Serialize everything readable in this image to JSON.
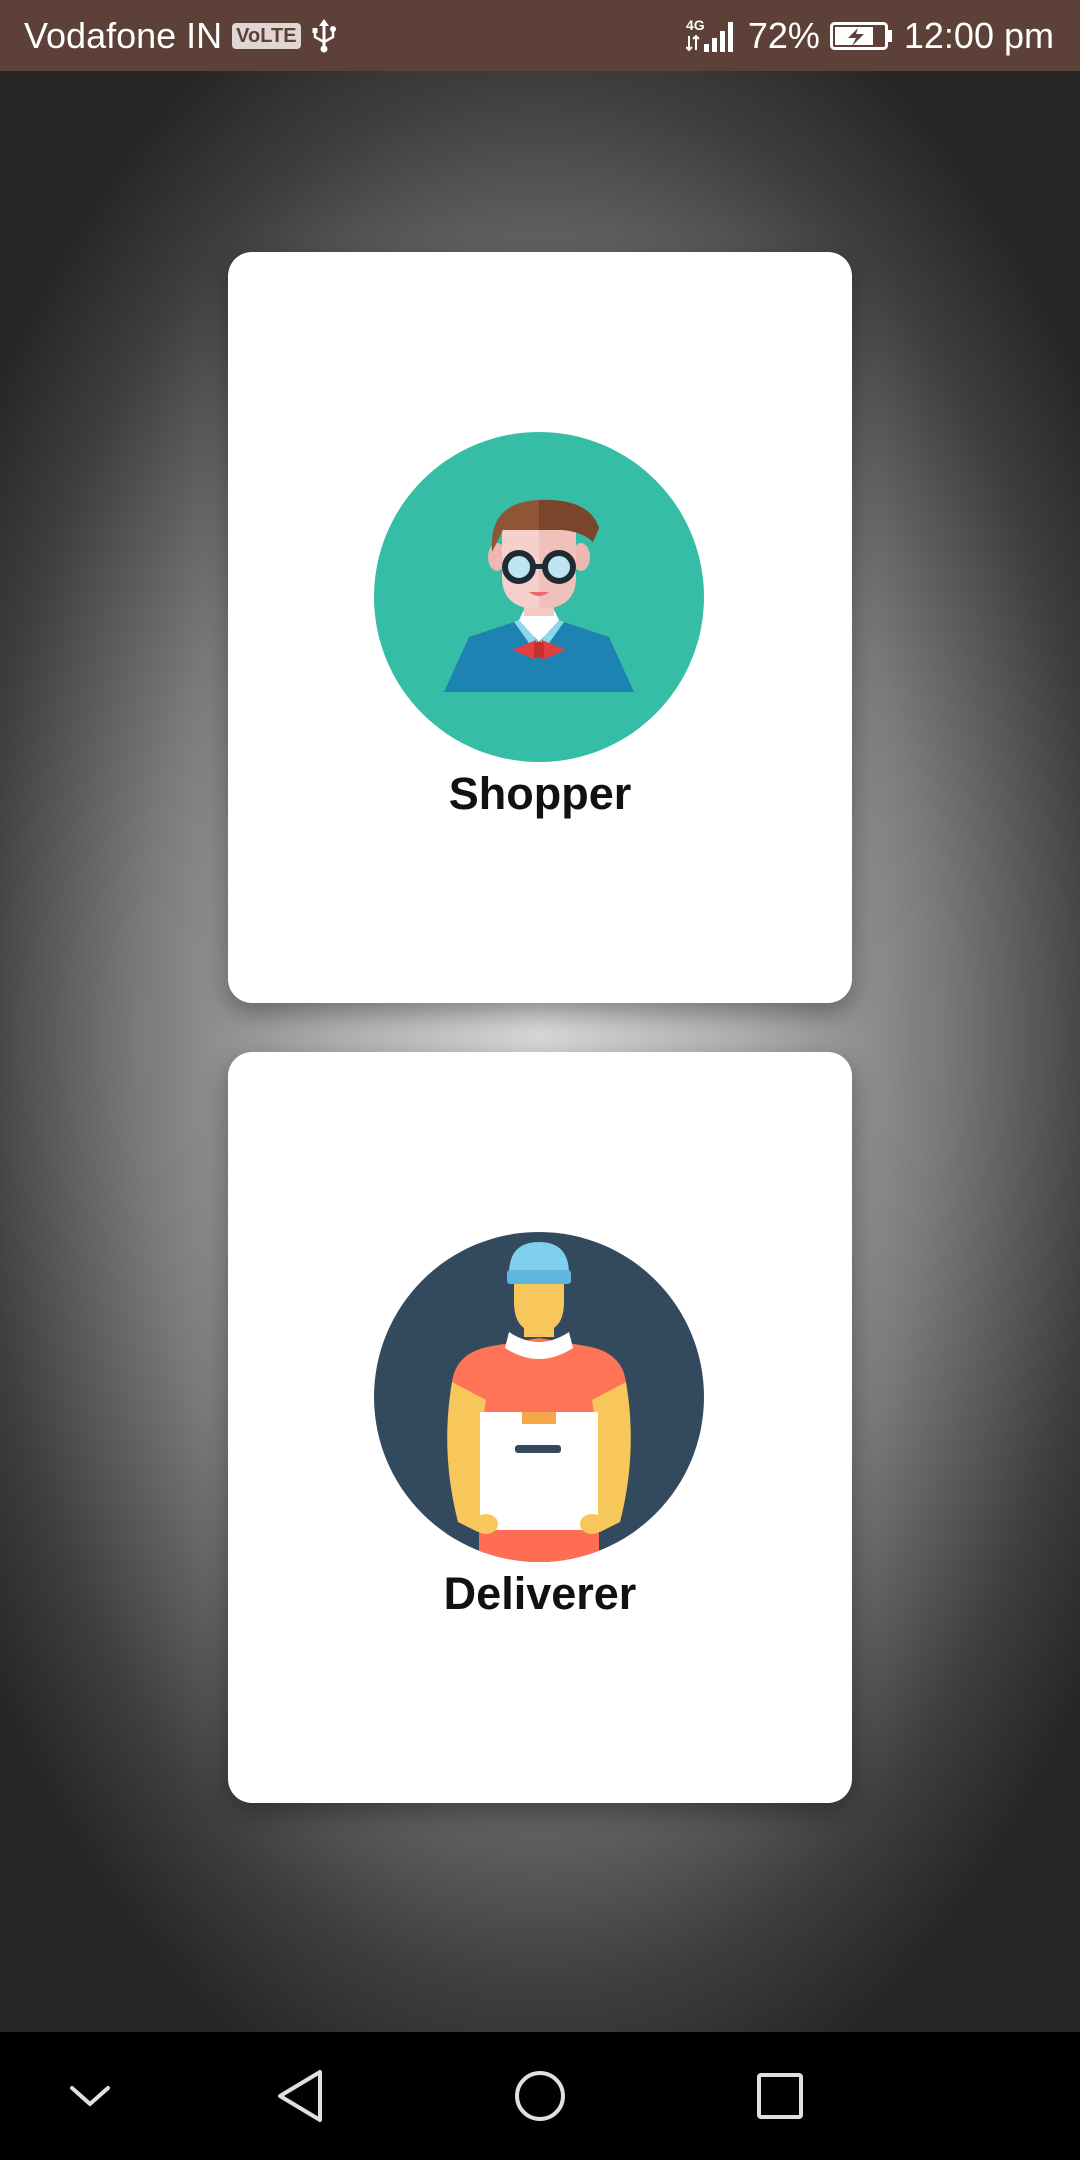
{
  "status_bar": {
    "carrier": "Vodafone IN",
    "volte_badge": "VoLTE",
    "network_type": "4G",
    "battery_percent": "72%",
    "time": "12:00 pm",
    "icons": [
      "volte-icon",
      "usb-icon",
      "signal-icon",
      "battery-charging-icon"
    ],
    "background_color": "#5d4037"
  },
  "roles": [
    {
      "label": "Shopper",
      "icon": "shopper-avatar-icon",
      "circle_color": "#36bda5"
    },
    {
      "label": "Deliverer",
      "icon": "deliverer-avatar-icon",
      "circle_color": "#33495e"
    }
  ],
  "nav_bar": {
    "buttons": [
      "collapse-chevron-icon",
      "back-icon",
      "home-icon",
      "recents-icon"
    ]
  }
}
